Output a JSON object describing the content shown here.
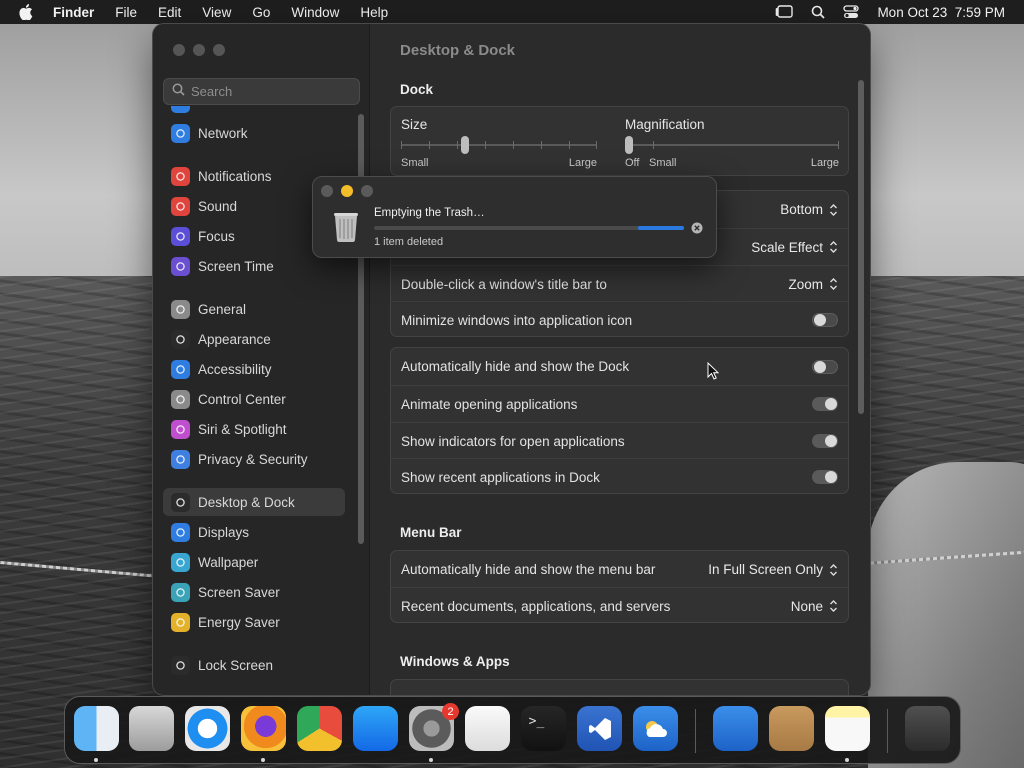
{
  "menubar": {
    "app_name": "Finder",
    "menus": [
      "File",
      "Edit",
      "View",
      "Go",
      "Window",
      "Help"
    ],
    "clock": "Mon Oct 23  7:59 PM"
  },
  "sidebar": {
    "search_placeholder": "Search",
    "items": [
      {
        "label": "Network",
        "icon": "globe-icon",
        "color": "#2f7de1"
      },
      {
        "label": "Notifications",
        "icon": "bell-icon",
        "color": "#e0453d"
      },
      {
        "label": "Sound",
        "icon": "speaker-icon",
        "color": "#e0453d"
      },
      {
        "label": "Focus",
        "icon": "moon-icon",
        "color": "#5a4fd6"
      },
      {
        "label": "Screen Time",
        "icon": "hourglass-icon",
        "color": "#6a4fd0"
      },
      {
        "label": "General",
        "icon": "gear-icon",
        "color": "#8a8a8a"
      },
      {
        "label": "Appearance",
        "icon": "appearance-icon",
        "color": "#2b2b2b"
      },
      {
        "label": "Accessibility",
        "icon": "accessibility-icon",
        "color": "#2f7de1"
      },
      {
        "label": "Control Center",
        "icon": "toggles-icon",
        "color": "#8a8a8a"
      },
      {
        "label": "Siri & Spotlight",
        "icon": "siri-icon",
        "color": "#c04fcf"
      },
      {
        "label": "Privacy & Security",
        "icon": "hand-icon",
        "color": "#3f7fe0"
      },
      {
        "label": "Desktop & Dock",
        "icon": "dock-icon",
        "color": "#2b2b2b"
      },
      {
        "label": "Displays",
        "icon": "sun-icon",
        "color": "#2f7de1"
      },
      {
        "label": "Wallpaper",
        "icon": "flower-icon",
        "color": "#38a6d0"
      },
      {
        "label": "Screen Saver",
        "icon": "screensaver-icon",
        "color": "#3aa3b8"
      },
      {
        "label": "Energy Saver",
        "icon": "bulb-icon",
        "color": "#e3b22a"
      },
      {
        "label": "Lock Screen",
        "icon": "lock-icon",
        "color": "#2b2b2b"
      }
    ]
  },
  "content": {
    "title": "Desktop & Dock",
    "dock_section": "Dock",
    "size": {
      "label": "Size",
      "min": "Small",
      "max": "Large"
    },
    "magnification": {
      "label": "Magnification",
      "off": "Off",
      "min": "Small",
      "max": "Large"
    },
    "position_value": "Bottom",
    "minimize_value": "Scale Effect",
    "double_click_label": "Double-click a window's title bar to",
    "double_click_value": "Zoom",
    "minimize_icon_label": "Minimize windows into application icon",
    "auto_hide_dock_label": "Automatically hide and show the Dock",
    "animate_label": "Animate opening applications",
    "indicators_label": "Show indicators for open applications",
    "recent_apps_label": "Show recent applications in Dock",
    "menubar_section": "Menu Bar",
    "auto_hide_menubar_label": "Automatically hide and show the menu bar",
    "auto_hide_menubar_value": "In Full Screen Only",
    "recent_docs_label": "Recent documents, applications, and servers",
    "recent_docs_value": "None",
    "windows_section": "Windows & Apps"
  },
  "trash_dialog": {
    "title": "Emptying the Trash…",
    "subtitle": "1 item deleted",
    "progress": 0.15
  },
  "dock": {
    "apps": [
      "Finder",
      "Launchpad",
      "Safari",
      "Firefox",
      "Chrome",
      "App Store",
      "System Settings",
      "TextEdit",
      "Terminal",
      "Instruments",
      "Visual Studio Code",
      "Weather",
      "Contacts",
      "Notes",
      "Trash"
    ],
    "settings_badge": "2"
  }
}
